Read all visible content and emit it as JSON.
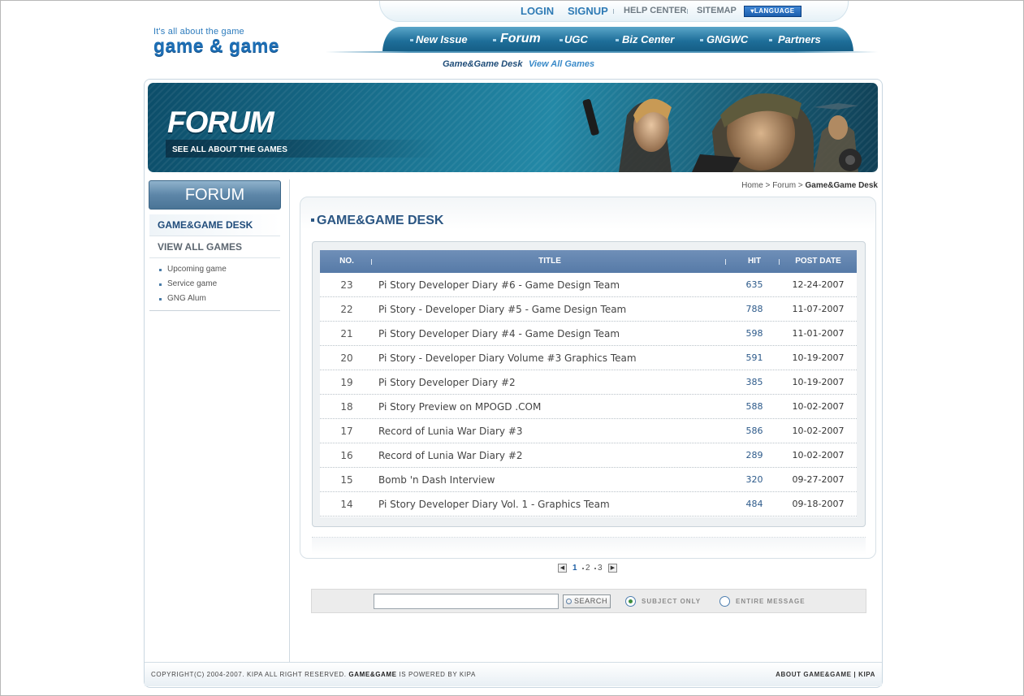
{
  "logo": {
    "tagline": "It's all about the game",
    "name": "game & game"
  },
  "top_links": {
    "login": "LOGIN",
    "signup": "SIGNUP",
    "help": "HELP CENTER",
    "sitemap": "SITEMAP",
    "language": "▾LANGUAGE"
  },
  "nav": {
    "items": [
      "New Issue",
      "Forum",
      "UGC",
      "Biz Center",
      "GNGWC",
      "Partners"
    ],
    "active": "Forum"
  },
  "subnav": {
    "desk": "Game&Game Desk",
    "all": "View All Games"
  },
  "banner": {
    "title": "FORUM",
    "subtitle": "SEE ALL ABOUT THE GAMES"
  },
  "sidebar": {
    "title": "FORUM",
    "items": [
      "GAME&GAME DESK",
      "VIEW ALL GAMES"
    ],
    "sub_items": [
      "Upcoming game",
      "Service game",
      "GNG Alum"
    ]
  },
  "breadcrumb": {
    "home": "Home",
    "sep1": " > ",
    "forum": "Forum",
    "sep2": " > ",
    "current": "Game&Game Desk"
  },
  "section_title": "GAME&GAME DESK",
  "table": {
    "headers": {
      "no": "NO.",
      "title": "TITLE",
      "hit": "HIT",
      "date": "POST DATE"
    },
    "rows": [
      {
        "no": "23",
        "title": "Pi Story Developer Diary #6 - Game Design Team",
        "hit": "635",
        "date": "12-24-2007"
      },
      {
        "no": "22",
        "title": "Pi Story - Developer Diary #5 - Game Design Team",
        "hit": "788",
        "date": "11-07-2007"
      },
      {
        "no": "21",
        "title": "Pi Story Developer Diary #4 - Game Design Team",
        "hit": "598",
        "date": "11-01-2007"
      },
      {
        "no": "20",
        "title": "Pi Story - Developer Diary Volume #3 Graphics Team",
        "hit": "591",
        "date": "10-19-2007"
      },
      {
        "no": "19",
        "title": "Pi Story Developer Diary #2",
        "hit": "385",
        "date": "10-19-2007"
      },
      {
        "no": "18",
        "title": "Pi Story Preview on MPOGD .COM",
        "hit": "588",
        "date": "10-02-2007"
      },
      {
        "no": "17",
        "title": "Record of Lunia War Diary #3",
        "hit": "586",
        "date": "10-02-2007"
      },
      {
        "no": "16",
        "title": "Record of Lunia War Diary #2",
        "hit": "289",
        "date": "10-02-2007"
      },
      {
        "no": "15",
        "title": "Bomb 'n Dash Interview",
        "hit": "320",
        "date": "09-27-2007"
      },
      {
        "no": "14",
        "title": "Pi Story Developer Diary Vol. 1 - Graphics Team",
        "hit": "484",
        "date": "09-18-2007"
      }
    ]
  },
  "pager": {
    "pages": [
      "1",
      "2",
      "3"
    ],
    "current": "1"
  },
  "search": {
    "value": "",
    "button": "SEARCH",
    "option_subject": "SUBJECT ONLY",
    "option_entire": "ENTIRE MESSAGE"
  },
  "footer": {
    "copyright": "COPYRIGHT(C) 2004-2007. KIPA ALL RIGHT RESERVED.",
    "brand": "GAME&GAME",
    "powered": "IS POWERED BY KIPA",
    "about": "ABOUT GAME&GAME",
    "sep": "|",
    "kipa": "KIPA"
  },
  "colors": {
    "accent": "#2b5683",
    "nav": "#1e6e99",
    "table_header": "#567aa7"
  }
}
